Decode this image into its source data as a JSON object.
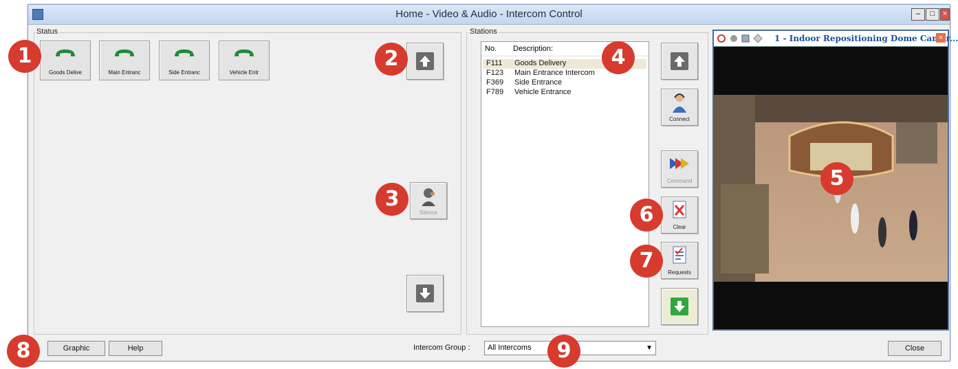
{
  "window": {
    "title": "Home - Video & Audio - Intercom Control"
  },
  "status_panel": {
    "label": "Status",
    "tiles": [
      {
        "label": "Goods Delive"
      },
      {
        "label": "Main Entranc"
      },
      {
        "label": "Side Entranc"
      },
      {
        "label": "Vehicle Entr"
      }
    ],
    "silence_label": "Silence"
  },
  "stations_panel": {
    "label": "Stations",
    "columns": {
      "no": "No.",
      "description": "Description:"
    },
    "rows": [
      {
        "no": "F111",
        "description": "Goods Delivery"
      },
      {
        "no": "F123",
        "description": "Main Entrance Intercom"
      },
      {
        "no": "F369",
        "description": "Side Entrance"
      },
      {
        "no": "F789",
        "description": "Vehicle Entrance"
      }
    ],
    "selected_row": 0,
    "buttons": {
      "connect": "Connect",
      "command": "Command",
      "clear": "Clear",
      "requests": "Requests"
    }
  },
  "video": {
    "title": "1 - Indoor Repositioning Dome Camer..."
  },
  "bottom_bar": {
    "graphic": "Graphic",
    "help": "Help",
    "group_label": "Intercom Group :",
    "group_value": "All Intercoms",
    "close": "Close"
  },
  "callouts": [
    "1",
    "2",
    "3",
    "4",
    "5",
    "6",
    "7",
    "8",
    "9"
  ],
  "colors": {
    "badge": "#d63b2e",
    "phone": "#1f8a3a",
    "green_button": "#2ea83e"
  }
}
